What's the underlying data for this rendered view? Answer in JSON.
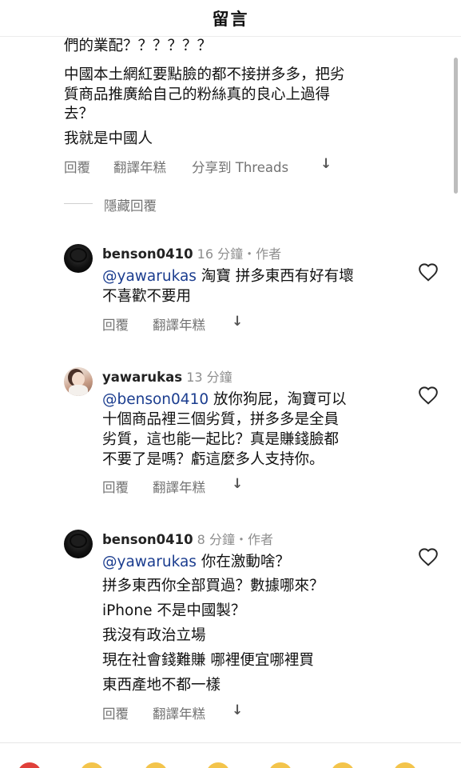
{
  "header": {
    "title": "留言"
  },
  "thread_top": {
    "lines": [
      "們的業配？？？？？？",
      "中國本土網紅要點臉的都不接拼多多，把劣",
      "質商品推廣給自己的粉絲真的良心上過得",
      "去？",
      "我就是中國人"
    ],
    "actions": {
      "reply": "回覆",
      "translate": "翻譯年糕",
      "share": "分享到 Threads",
      "more": "↓"
    },
    "hide_replies": "隱藏回覆"
  },
  "comments": [
    {
      "username": "benson0410",
      "time": "16 分鐘",
      "author_tag": "・作者",
      "mention": "@yawarukas",
      "lines": [
        "淘寶 拼多東西有好有壞",
        "不喜歡不要用"
      ],
      "actions": {
        "reply": "回覆",
        "translate": "翻譯年糕",
        "more": "↓"
      }
    },
    {
      "username": "yawarukas",
      "time": "13 分鐘",
      "author_tag": "",
      "mention": "@benson0410",
      "lines": [
        "放你狗屁，淘寶可以",
        "十個商品裡三個劣質，拼多多是全員",
        "劣質，這也能一起比？真是賺錢臉都",
        "不要了是嗎？虧這麼多人支持你。"
      ],
      "actions": {
        "reply": "回覆",
        "translate": "翻譯年糕",
        "more": "↓"
      }
    },
    {
      "username": "benson0410",
      "time": "8 分鐘",
      "author_tag": "・作者",
      "mention": "@yawarukas",
      "lines": [
        "你在激動啥？",
        "拼多東西你全部買過？數據哪來？",
        "iPhone 不是中國製？",
        "我沒有政治立場",
        "現在社會錢難賺 哪裡便宜哪裡買",
        "東西產地不都一樣"
      ],
      "actions": {
        "reply": "回覆",
        "translate": "翻譯年糕",
        "more": "↓"
      }
    }
  ],
  "colors": {
    "mention": "#1b3d8f",
    "meta": "#8e8e8e",
    "text": "#111111"
  }
}
